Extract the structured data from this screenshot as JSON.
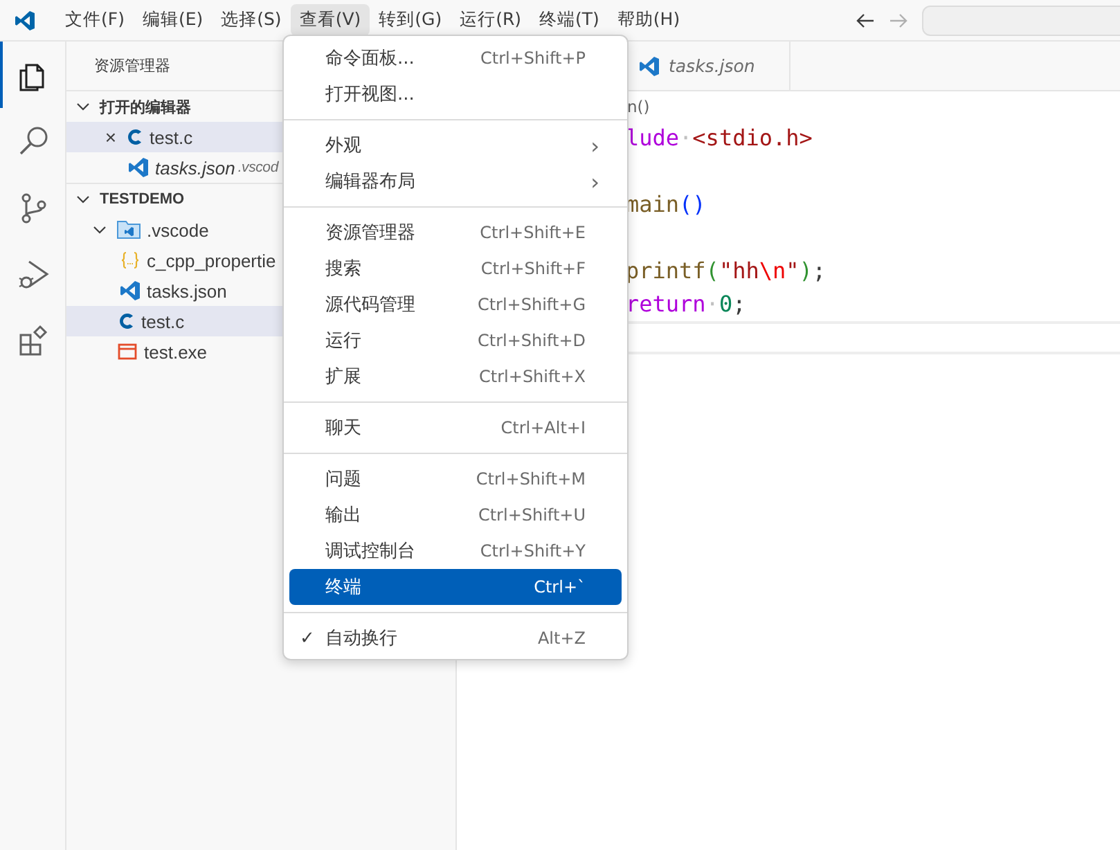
{
  "menu_bar": [
    {
      "label": "文件(F)",
      "selected": false
    },
    {
      "label": "编辑(E)",
      "selected": false
    },
    {
      "label": "选择(S)",
      "selected": false
    },
    {
      "label": "查看(V)",
      "selected": true
    },
    {
      "label": "转到(G)",
      "selected": false
    },
    {
      "label": "运行(R)",
      "selected": false
    },
    {
      "label": "终端(T)",
      "selected": false
    },
    {
      "label": "帮助(H)",
      "selected": false
    }
  ],
  "activity_bar": [
    {
      "kind": "explorer",
      "selected": true
    },
    {
      "kind": "search",
      "selected": false
    },
    {
      "kind": "source-control",
      "selected": false
    },
    {
      "kind": "run-debug",
      "selected": false
    },
    {
      "kind": "extensions",
      "selected": false
    }
  ],
  "sidebar": {
    "title": "资源管理器",
    "sections": [
      {
        "title": "打开的编辑器",
        "expanded": true,
        "items": [
          {
            "kind": "c",
            "name": "test.c",
            "selected": true,
            "close": "×",
            "preview": false
          },
          {
            "kind": "vscode",
            "name": "tasks.json",
            "description": ".vscod",
            "selected": false,
            "preview": true
          }
        ]
      },
      {
        "title": "TESTDEMO",
        "expanded": true,
        "items": [
          {
            "kind": "folder",
            "name": ".vscode",
            "selected": false,
            "expanded": true,
            "children": [
              {
                "kind": "braces",
                "name": "c_cpp_propertie",
                "selected": false
              },
              {
                "kind": "vscode",
                "name": "tasks.json",
                "selected": false
              }
            ]
          },
          {
            "kind": "c",
            "name": "test.c",
            "selected": true
          },
          {
            "kind": "exe",
            "name": "test.exe",
            "selected": false
          }
        ]
      }
    ]
  },
  "editor": {
    "tabs": [
      {
        "name": "tasks.json",
        "kind": "vscode",
        "preview": true
      }
    ],
    "breadcrumb": "n()",
    "lines": [
      {
        "kind": "code",
        "tokens": [
          {
            "kind": "keyword",
            "text": "lude"
          },
          {
            "kind": "space",
            "text": "·"
          },
          {
            "kind": "string",
            "text": "<stdio.h>"
          }
        ]
      },
      {
        "kind": "blank"
      },
      {
        "kind": "code",
        "tokens": [
          {
            "kind": "function",
            "text": "main"
          },
          {
            "kind": "bracket",
            "text": "()"
          }
        ]
      },
      {
        "kind": "blank"
      },
      {
        "kind": "code",
        "tokens": [
          {
            "kind": "function",
            "text": "printf"
          },
          {
            "kind": "bracket2",
            "text": "("
          },
          {
            "kind": "string",
            "text": "\"hh"
          },
          {
            "kind": "escape",
            "text": "\\n"
          },
          {
            "kind": "string",
            "text": "\""
          },
          {
            "kind": "bracket2",
            "text": ")"
          },
          {
            "kind": "plain",
            "text": ";"
          }
        ]
      },
      {
        "kind": "code",
        "tokens": [
          {
            "kind": "keyword",
            "text": "return"
          },
          {
            "kind": "space",
            "text": "·"
          },
          {
            "kind": "number",
            "text": "0"
          },
          {
            "kind": "plain",
            "text": ";"
          }
        ]
      },
      {
        "kind": "current"
      }
    ]
  },
  "view_menu": {
    "items": [
      {
        "kind": "item",
        "label": "命令面板...",
        "shortcut": "Ctrl+Shift+P",
        "selected": false
      },
      {
        "kind": "item",
        "label": "打开视图...",
        "selected": false
      },
      {
        "kind": "separator"
      },
      {
        "kind": "submenu",
        "label": "外观",
        "arrow": "›",
        "selected": false
      },
      {
        "kind": "submenu",
        "label": "编辑器布局",
        "arrow": "›",
        "selected": false
      },
      {
        "kind": "separator"
      },
      {
        "kind": "item",
        "label": "资源管理器",
        "shortcut": "Ctrl+Shift+E",
        "selected": false
      },
      {
        "kind": "item",
        "label": "搜索",
        "shortcut": "Ctrl+Shift+F",
        "selected": false
      },
      {
        "kind": "item",
        "label": "源代码管理",
        "shortcut": "Ctrl+Shift+G",
        "selected": false
      },
      {
        "kind": "item",
        "label": "运行",
        "shortcut": "Ctrl+Shift+D",
        "selected": false
      },
      {
        "kind": "item",
        "label": "扩展",
        "shortcut": "Ctrl+Shift+X",
        "selected": false
      },
      {
        "kind": "separator"
      },
      {
        "kind": "item",
        "label": "聊天",
        "shortcut": "Ctrl+Alt+I",
        "selected": false
      },
      {
        "kind": "separator"
      },
      {
        "kind": "item",
        "label": "问题",
        "shortcut": "Ctrl+Shift+M",
        "selected": false
      },
      {
        "kind": "item",
        "label": "输出",
        "shortcut": "Ctrl+Shift+U",
        "selected": false
      },
      {
        "kind": "item",
        "label": "调试控制台",
        "shortcut": "Ctrl+Shift+Y",
        "selected": false
      },
      {
        "kind": "item",
        "label": "终端",
        "shortcut": "Ctrl+`",
        "selected": true
      },
      {
        "kind": "separator"
      },
      {
        "kind": "item",
        "label": "自动换行",
        "shortcut": "Alt+Z",
        "selected": false,
        "checked": true,
        "check": "✓"
      }
    ]
  }
}
